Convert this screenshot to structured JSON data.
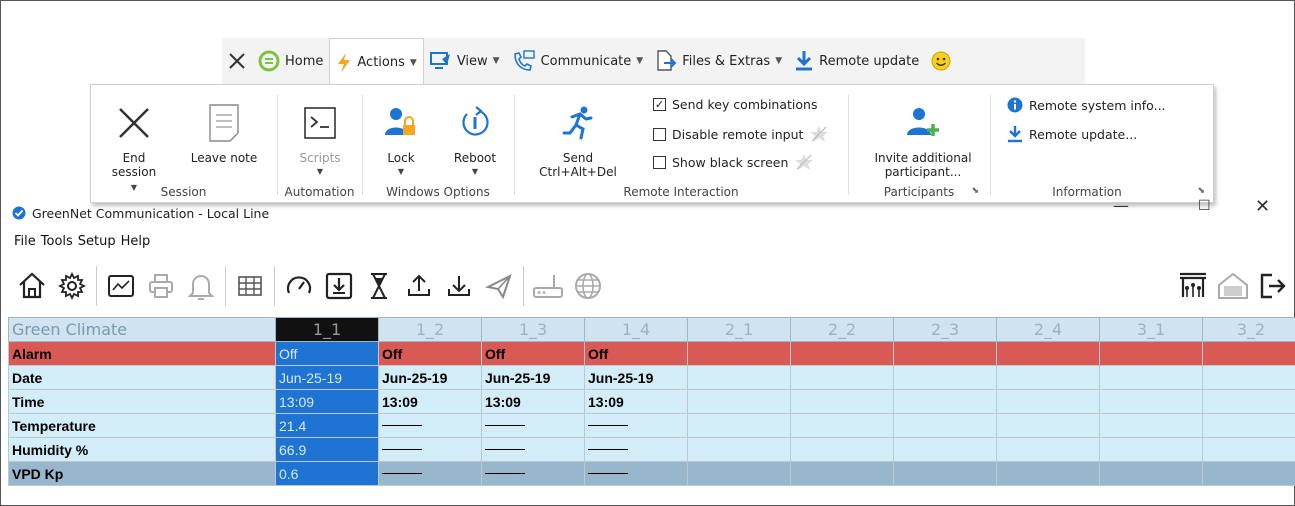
{
  "teamviewer": {
    "tabs": [
      {
        "label": "Home"
      },
      {
        "label": "Actions"
      },
      {
        "label": "View"
      },
      {
        "label": "Communicate"
      },
      {
        "label": "Files & Extras"
      },
      {
        "label": "Remote update"
      }
    ],
    "ribbon": {
      "session": {
        "end_session_line1": "End",
        "end_session_line2": "session",
        "leave_note": "Leave note",
        "group_label": "Session"
      },
      "automation": {
        "scripts": "Scripts",
        "group_label": "Automation"
      },
      "windows_options": {
        "lock": "Lock",
        "reboot": "Reboot",
        "group_label": "Windows Options"
      },
      "remote_interaction": {
        "send_line1": "Send",
        "send_line2": "Ctrl+Alt+Del",
        "send_key_combinations": "Send key combinations",
        "disable_remote_input": "Disable remote input",
        "show_black_screen": "Show black screen",
        "group_label": "Remote Interaction"
      },
      "participants": {
        "invite_line1": "Invite additional",
        "invite_line2": "participant...",
        "group_label": "Participants"
      },
      "information": {
        "remote_system_info": "Remote system info...",
        "remote_update": "Remote update...",
        "group_label": "Information"
      }
    }
  },
  "window": {
    "title": "GreenNet Communication - Local Line"
  },
  "menu": [
    "File",
    "Tools",
    "Setup",
    "Help"
  ],
  "grid": {
    "title": "Green Climate",
    "columns": [
      "1_1",
      "1_2",
      "1_3",
      "1_4",
      "2_1",
      "2_2",
      "2_3",
      "2_4",
      "3_1",
      "3_2"
    ],
    "rows": [
      {
        "label": "Alarm",
        "values": [
          "Off",
          "Off",
          "Off",
          "Off"
        ]
      },
      {
        "label": "Date",
        "values": [
          "Jun-25-19",
          "Jun-25-19",
          "Jun-25-19",
          "Jun-25-19"
        ]
      },
      {
        "label": "Time",
        "values": [
          "13:09",
          "13:09",
          "13:09",
          "13:09"
        ]
      },
      {
        "label": "Temperature",
        "values": [
          "21.4"
        ]
      },
      {
        "label": "Humidity %",
        "values": [
          "66.9"
        ]
      },
      {
        "label": "VPD Kp",
        "values": [
          "0.6"
        ]
      }
    ]
  },
  "colors": {
    "accent_blue": "#1f73d3",
    "alarm_red": "#d95a55",
    "row_light": "#d2ecf8",
    "row_vpd": "#98b6cc",
    "green_logo": "#7ec242"
  }
}
